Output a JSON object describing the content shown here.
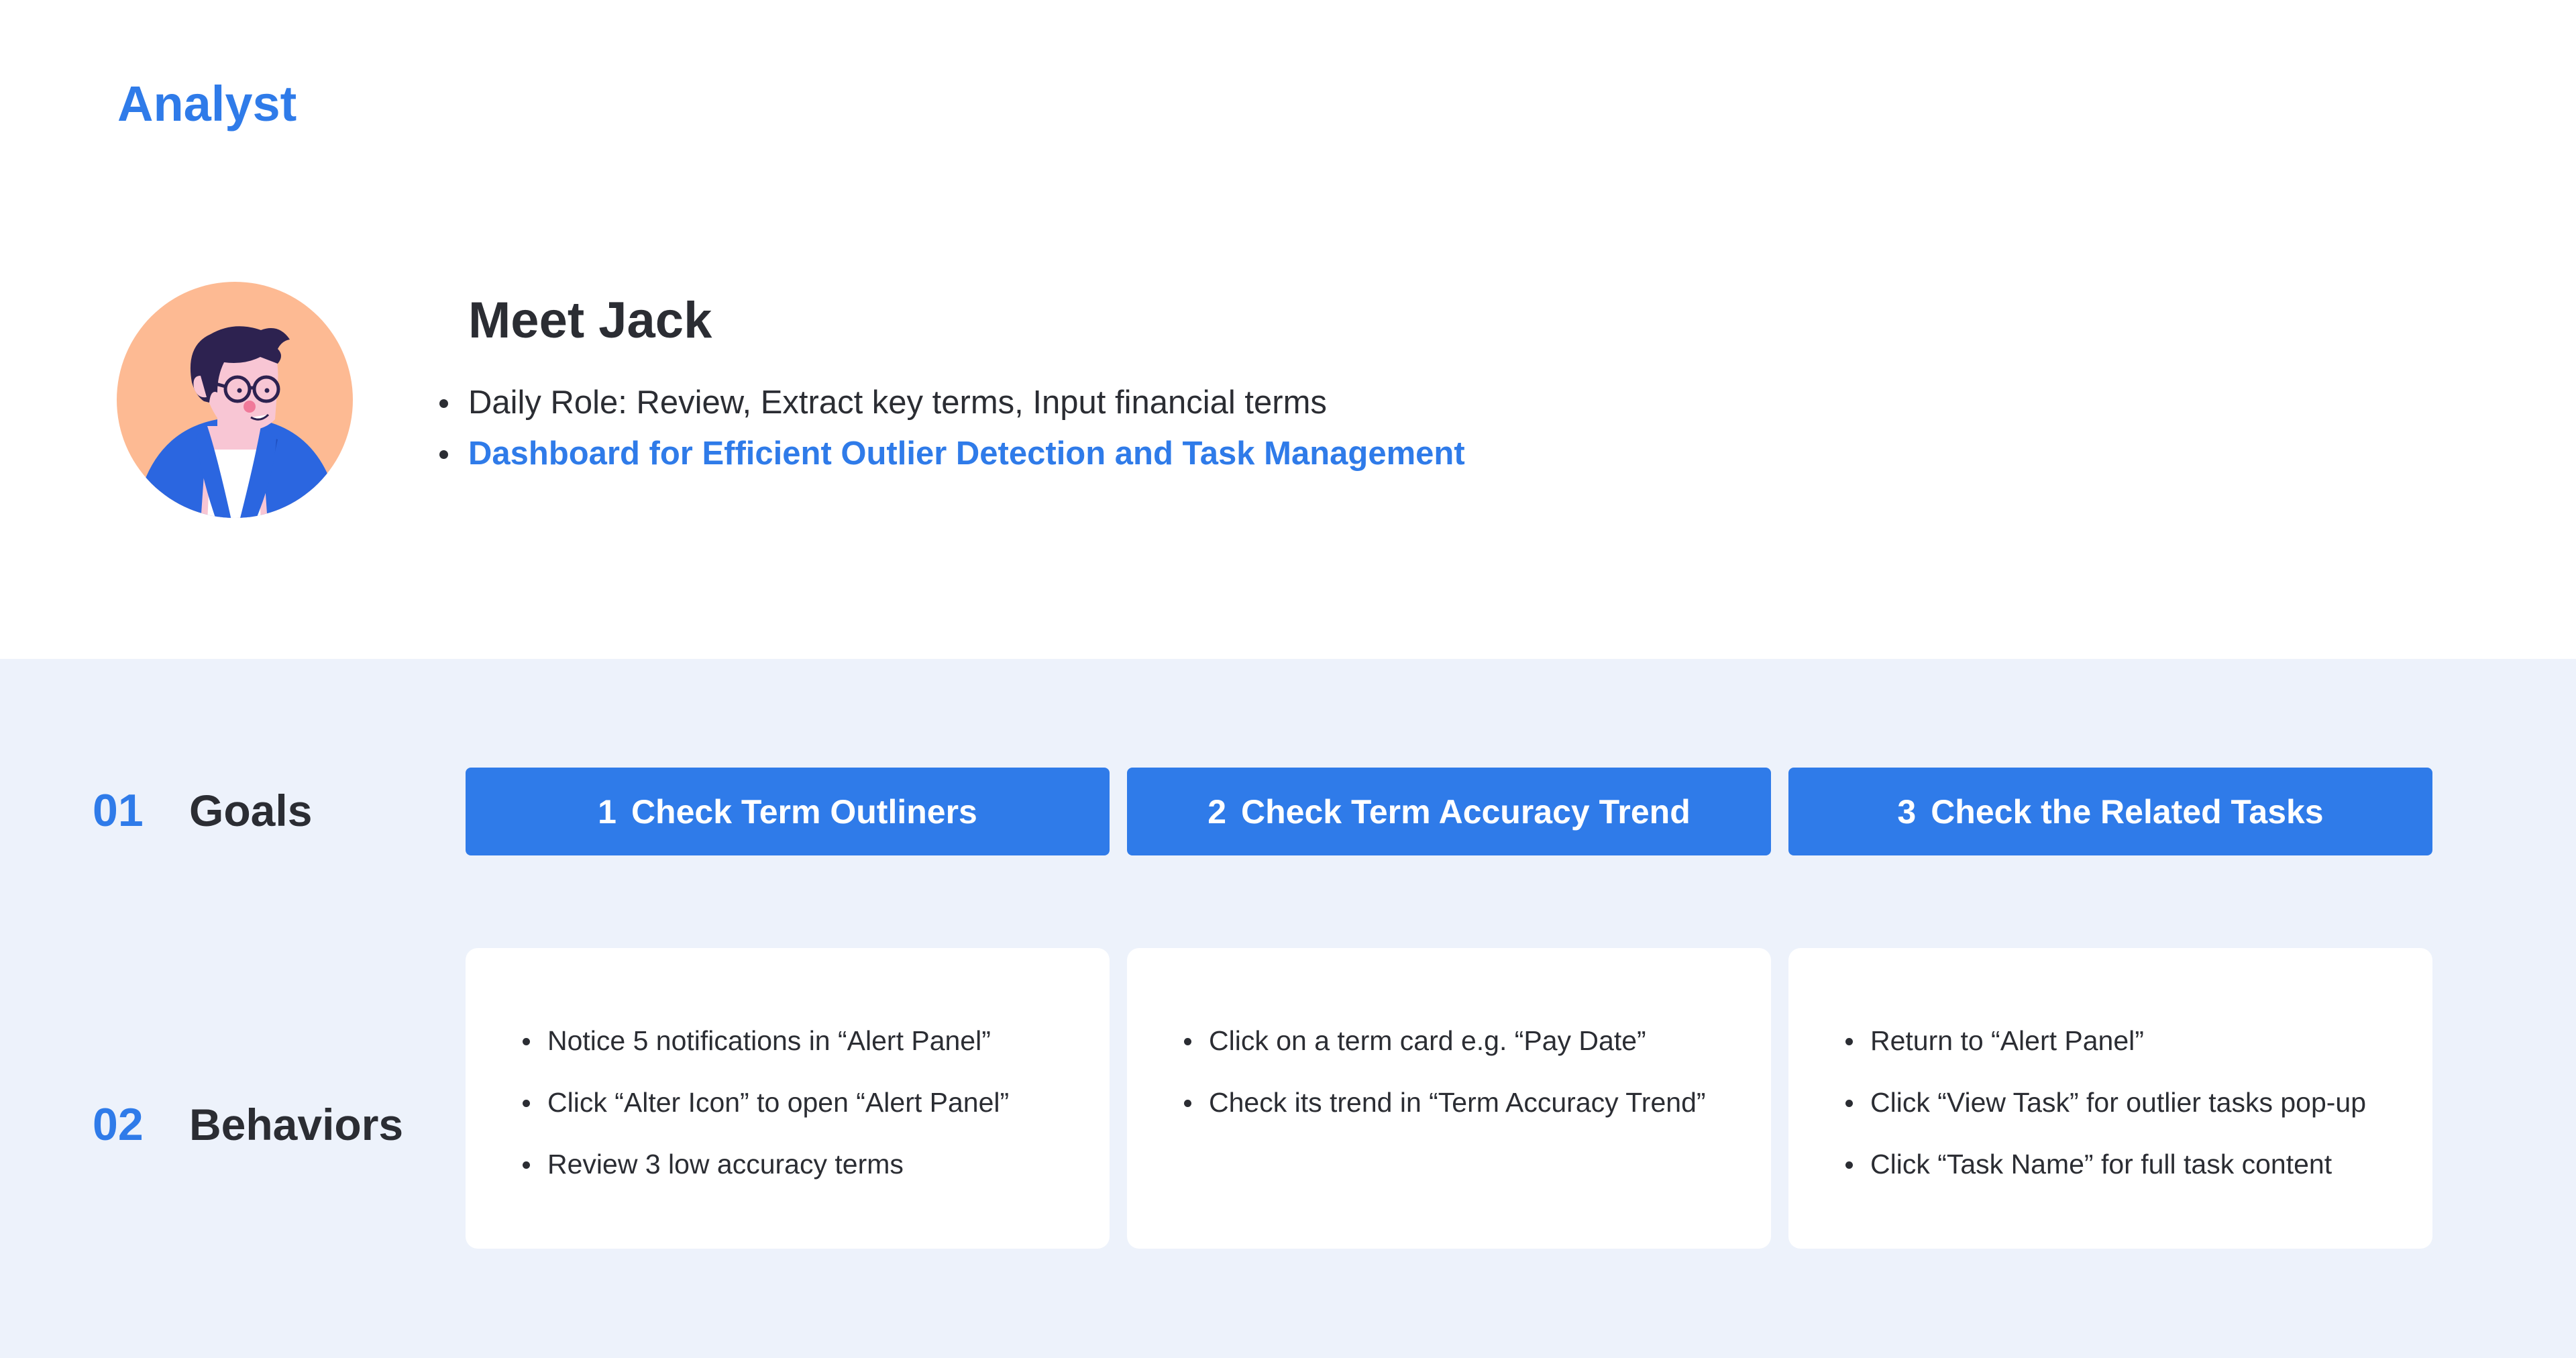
{
  "header": {
    "role_title": "Analyst"
  },
  "persona": {
    "avatar_icon": "man-with-glasses-avatar",
    "name": "Meet Jack",
    "bullets": [
      "Daily Role: Review, Extract key terms, Input financial terms",
      "Dashboard for Efficient Outlier Detection and Task Management"
    ]
  },
  "goals": {
    "number": "01",
    "label": "Goals",
    "items": [
      {
        "num": "1",
        "label": "Check Term Outliners"
      },
      {
        "num": "2",
        "label": "Check Term Accuracy Trend"
      },
      {
        "num": "3",
        "label": "Check the Related Tasks"
      }
    ]
  },
  "behaviors": {
    "number": "02",
    "label": "Behaviors",
    "cards": [
      {
        "items": [
          "Notice 5 notifications in “Alert Panel”",
          "Click “Alter Icon” to open “Alert Panel”",
          "Review 3 low accuracy terms"
        ]
      },
      {
        "items": [
          "Click on a term card e.g. “Pay Date”",
          "Check its trend in “Term Accuracy Trend”"
        ]
      },
      {
        "items": [
          "Return to “Alert Panel”",
          "Click “View Task” for outlier tasks pop-up",
          "Click “Task Name” for full task content"
        ]
      }
    ]
  },
  "colors": {
    "accent": "#2f7be9",
    "section_background": "#edf2fb",
    "text": "#2b2d33"
  }
}
